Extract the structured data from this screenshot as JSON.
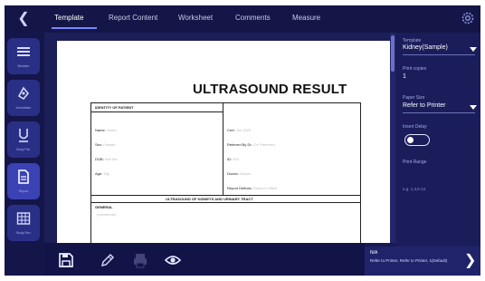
{
  "tabs": [
    {
      "label": "Template",
      "active": true
    },
    {
      "label": "Report Content",
      "active": false
    },
    {
      "label": "Worksheet",
      "active": false
    },
    {
      "label": "Comments",
      "active": false
    },
    {
      "label": "Measure",
      "active": false
    }
  ],
  "sidebar": {
    "items": [
      {
        "label": "Browser",
        "icon": "list-icon"
      },
      {
        "label": "Annotation",
        "icon": "annotation-icon"
      },
      {
        "label": "Body Pat.",
        "icon": "body-pattern-icon"
      },
      {
        "label": "Report",
        "icon": "report-icon",
        "selected": true
      },
      {
        "label": "Study Rev.",
        "icon": "grid-icon"
      }
    ]
  },
  "document": {
    "title": "ULTRASOUND RESULT",
    "identity_header": "IDENTITY OF PATIENT",
    "left_fields": [
      {
        "label": "Name:",
        "value": "Jones"
      },
      {
        "label": "Sex:",
        "value": "Female"
      },
      {
        "label": "DOB:",
        "value": "Not Set"
      },
      {
        "label": "Age:",
        "value": "28y"
      }
    ],
    "right_fields": [
      {
        "label": "Cert:",
        "value": "Jun 2020"
      },
      {
        "label": "Referred By Dr.:",
        "value": "Dr. Preferred"
      },
      {
        "label": "ID:",
        "value": "003"
      },
      {
        "label": "Doctor:",
        "value": "Doctor"
      },
      {
        "label": "Report Defines:",
        "value": "Doctor's Office"
      }
    ],
    "section_title": "ULTRASOUND OF KIDNEYS AND URINARY TRACT",
    "general_label": "GENERAL",
    "general_value": "(comments)"
  },
  "right_panel": {
    "template_label": "Template",
    "template_value": "Kidney(Sample)",
    "print_copies_label": "Print copies",
    "print_copies_value": "1",
    "paper_size_label": "Paper Size",
    "paper_size_value": "Refer to Printer",
    "insert_delay_label": "Insert Delay",
    "print_range_label": "Print Range",
    "print_range_value": "e.g. 1,3,5-12"
  },
  "printer": {
    "name": "N/A",
    "description": "Refer to Printer, Refer to Printer, 1(Default)"
  },
  "colors": {
    "app_bg": "#181a52",
    "accent": "#3a42b4",
    "panel": "#1b1d5a"
  }
}
